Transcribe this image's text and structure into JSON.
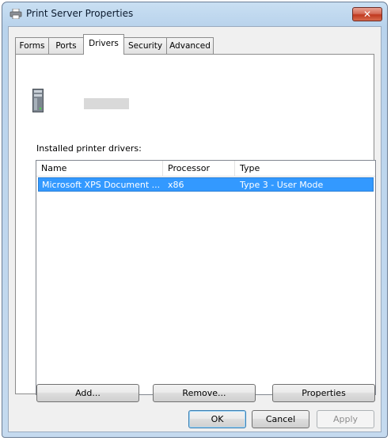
{
  "window": {
    "title": "Print Server Properties",
    "close_label": "✕"
  },
  "tabs": [
    {
      "label": "Forms"
    },
    {
      "label": "Ports"
    },
    {
      "label": "Drivers"
    },
    {
      "label": "Security"
    },
    {
      "label": "Advanced"
    }
  ],
  "active_tab": "Drivers",
  "drivers": {
    "list_label": "Installed printer drivers:",
    "columns": [
      "Name",
      "Processor",
      "Type"
    ],
    "rows": [
      {
        "name": "Microsoft XPS Document ...",
        "processor": "x86",
        "type": "Type 3 - User Mode",
        "selected": true
      }
    ]
  },
  "driver_buttons": {
    "add": "Add...",
    "remove": "Remove...",
    "properties": "Properties"
  },
  "dialog_buttons": {
    "ok": "OK",
    "cancel": "Cancel",
    "apply": "Apply"
  },
  "colors": {
    "selection": "#3399ff",
    "close_button": "#c7402a",
    "titlebar": "#c0d8ee"
  }
}
